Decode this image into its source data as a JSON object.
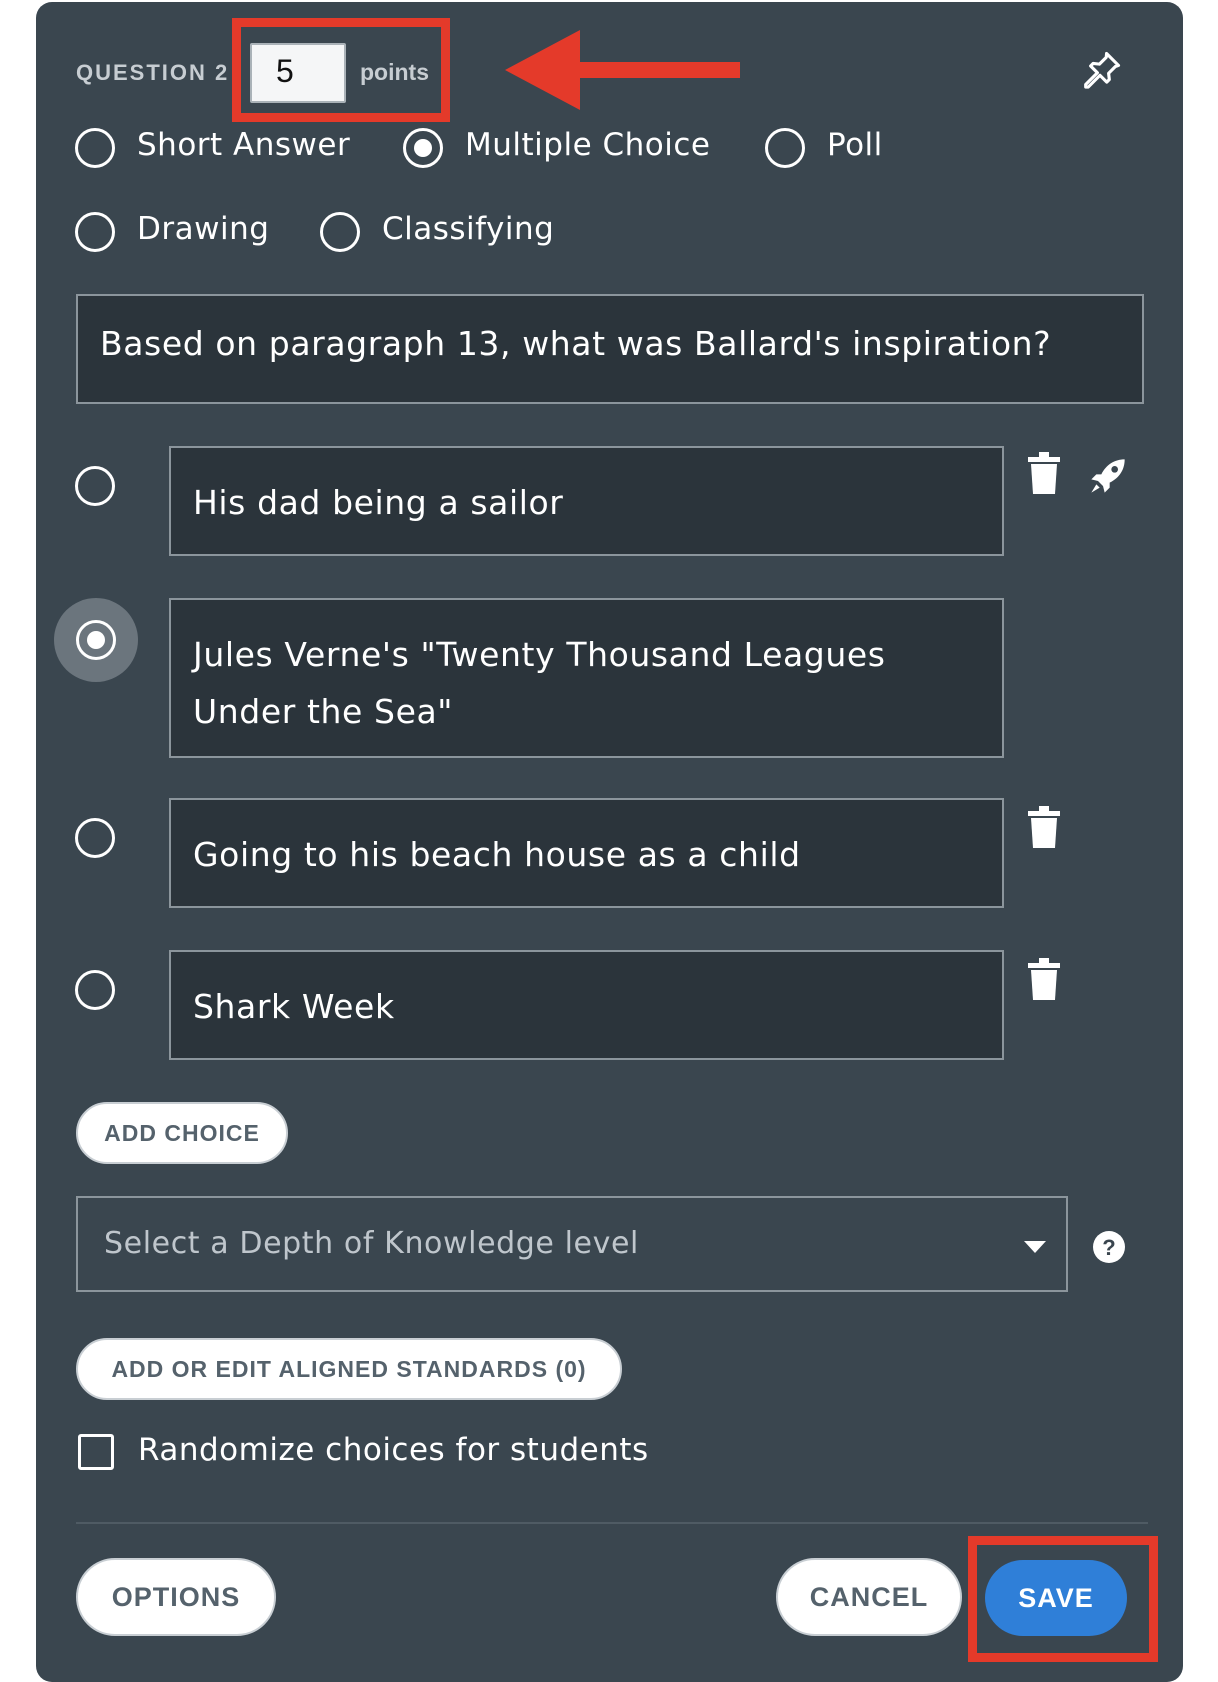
{
  "question": {
    "label": "QUESTION 2",
    "points_value": "5",
    "points_label": "points"
  },
  "icons": {
    "pin": "pushpin-icon",
    "trash": "trash-icon",
    "rocket": "rocket-icon",
    "help": "question-circle-icon",
    "arrow": "red-arrow-annotation"
  },
  "types": [
    {
      "label": "Short Answer",
      "selected": false
    },
    {
      "label": "Multiple Choice",
      "selected": true
    },
    {
      "label": "Poll",
      "selected": false
    },
    {
      "label": "Drawing",
      "selected": false
    },
    {
      "label": "Classifying",
      "selected": false
    }
  ],
  "prompt": "Based on paragraph 13, what was Ballard's inspiration?",
  "choices": [
    {
      "text": "His dad being a sailor",
      "correct": false
    },
    {
      "text": "Jules Verne's \"Twenty Thousand Leagues Under the Sea\"",
      "correct": true
    },
    {
      "text": "Going to his beach house as a child",
      "correct": false
    },
    {
      "text": "Shark Week",
      "correct": false
    }
  ],
  "buttons": {
    "add_choice": "ADD CHOICE",
    "standards": "ADD OR EDIT ALIGNED STANDARDS (0)",
    "options": "OPTIONS",
    "cancel": "CANCEL",
    "save": "SAVE"
  },
  "dok": {
    "placeholder": "Select a Depth of Knowledge level"
  },
  "randomize": {
    "label": "Randomize choices for students",
    "checked": false
  },
  "colors": {
    "panel": "#3a464f",
    "field": "#2b343b",
    "accent": "#2f7fd8",
    "annotation": "#e43a2a"
  }
}
